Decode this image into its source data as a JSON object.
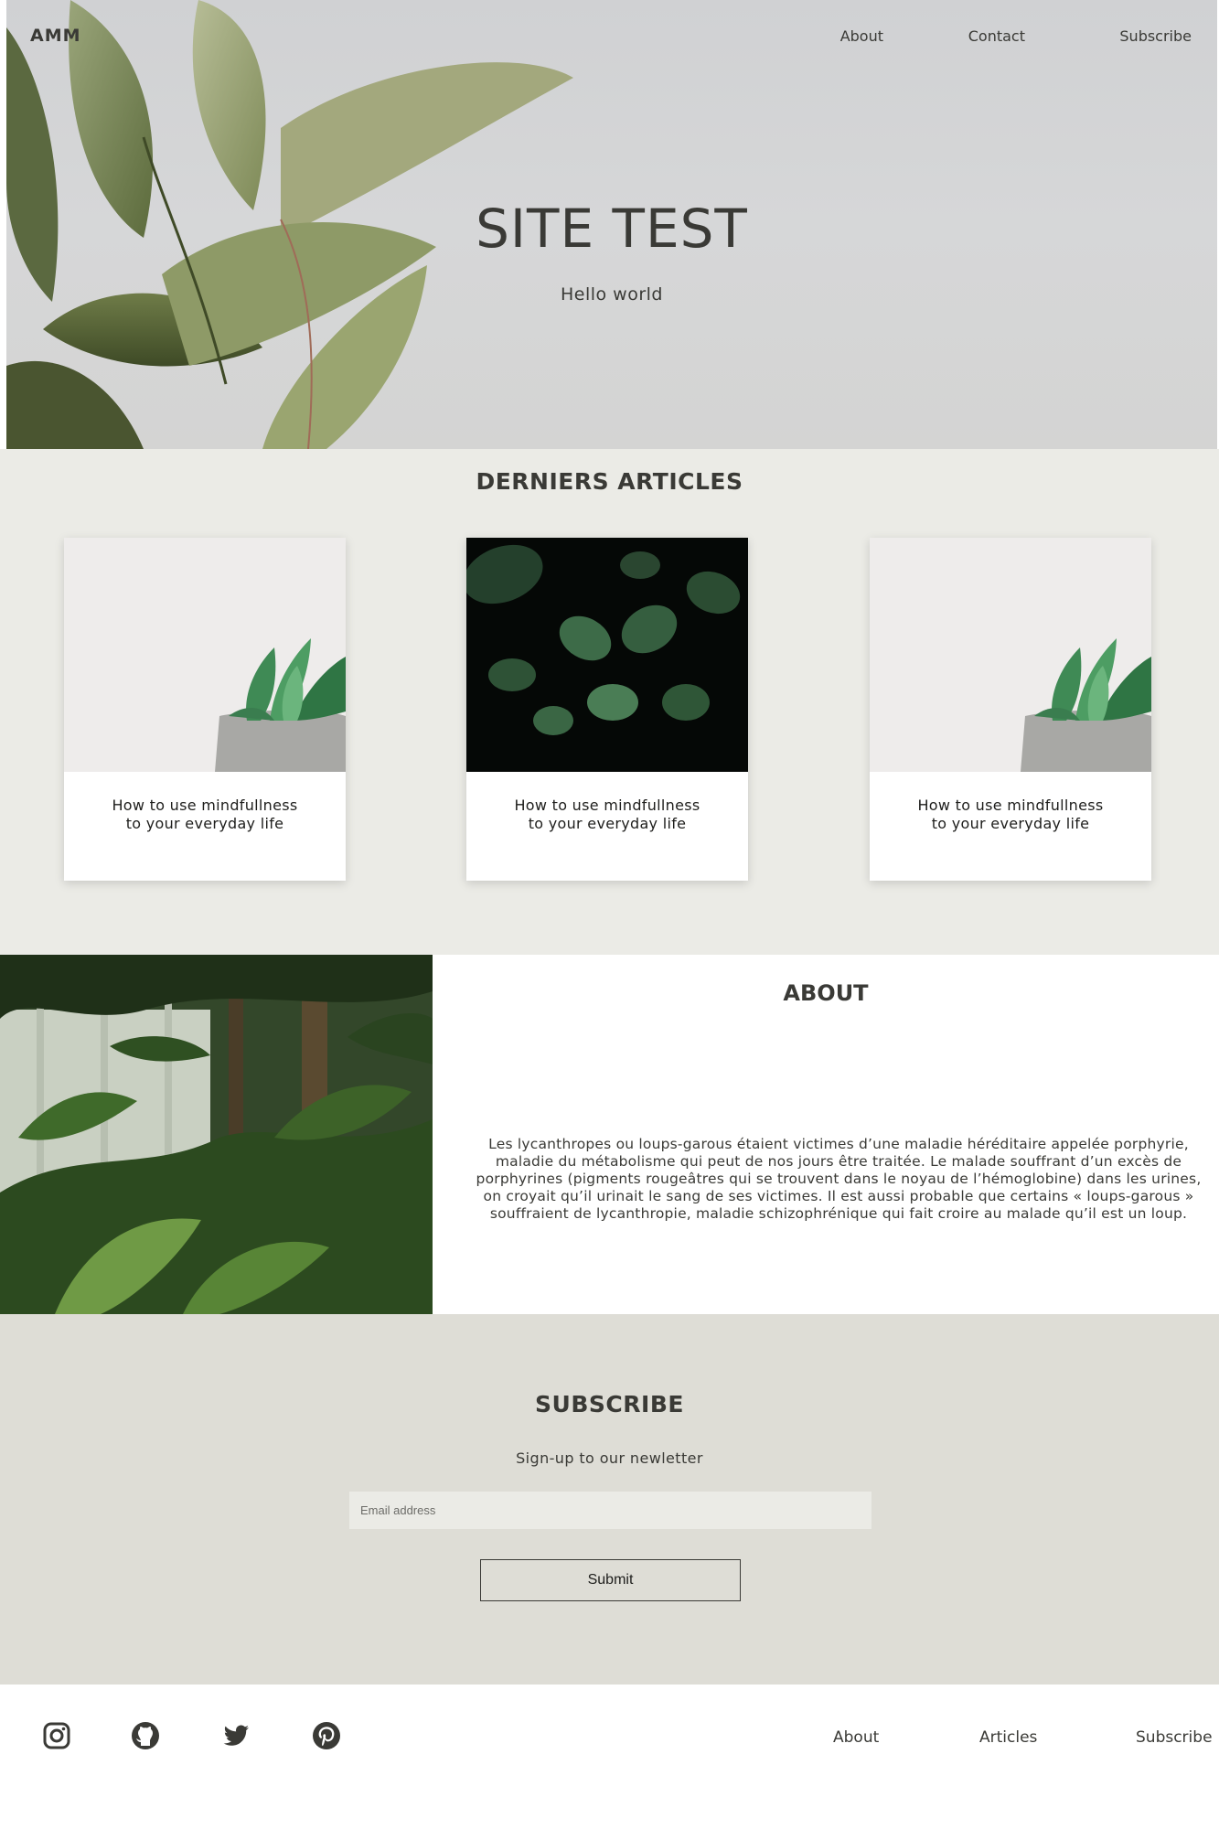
{
  "header": {
    "logo": "AMM",
    "nav": [
      {
        "label": "About"
      },
      {
        "label": "Contact"
      },
      {
        "label": "Subscribe"
      }
    ]
  },
  "hero": {
    "title": "SITE TEST",
    "subtitle": "Hello world"
  },
  "articles": {
    "title": "DERNIERS ARTICLES",
    "cards": [
      {
        "line1": "How to use mindfullness",
        "line2": "to your everyday life",
        "image": "succulent-pot"
      },
      {
        "line1": "How to use mindfullness",
        "line2": "to your everyday life",
        "image": "dark-leaves"
      },
      {
        "line1": "How to use mindfullness",
        "line2": "to your everyday life",
        "image": "succulent-pot"
      }
    ]
  },
  "about": {
    "title": "ABOUT",
    "text": "Les lycanthropes ou loups-garous étaient victimes d’une maladie héréditaire appelée porphyrie, maladie du métabolisme qui peut de nos jours être traitée. Le malade souffrant d’un excès de porphyrines (pigments rougeâtres qui se trouvent dans le noyau de l’hémoglobine) dans les urines, on croyait qu’il urinait le sang de ses victimes. Il est aussi probable que certains « loups-garous » souffraient de lycanthropie, maladie schizophrénique qui fait croire au malade qu’il est un loup."
  },
  "subscribe": {
    "title": "SUBSCRIBE",
    "text": "Sign-up to our newletter",
    "email_placeholder": "Email address",
    "submit_label": "Submit"
  },
  "footer": {
    "social": [
      {
        "icon": "instagram-icon"
      },
      {
        "icon": "github-icon"
      },
      {
        "icon": "twitter-icon"
      },
      {
        "icon": "pinterest-icon"
      }
    ],
    "nav": [
      {
        "label": "About"
      },
      {
        "label": "Articles"
      },
      {
        "label": "Subscribe"
      }
    ]
  },
  "colors": {
    "text": "#3a3a36",
    "articles_bg": "#ebebe6",
    "subscribe_bg": "#deddd6",
    "hero_bg": "#d3d4d5"
  }
}
